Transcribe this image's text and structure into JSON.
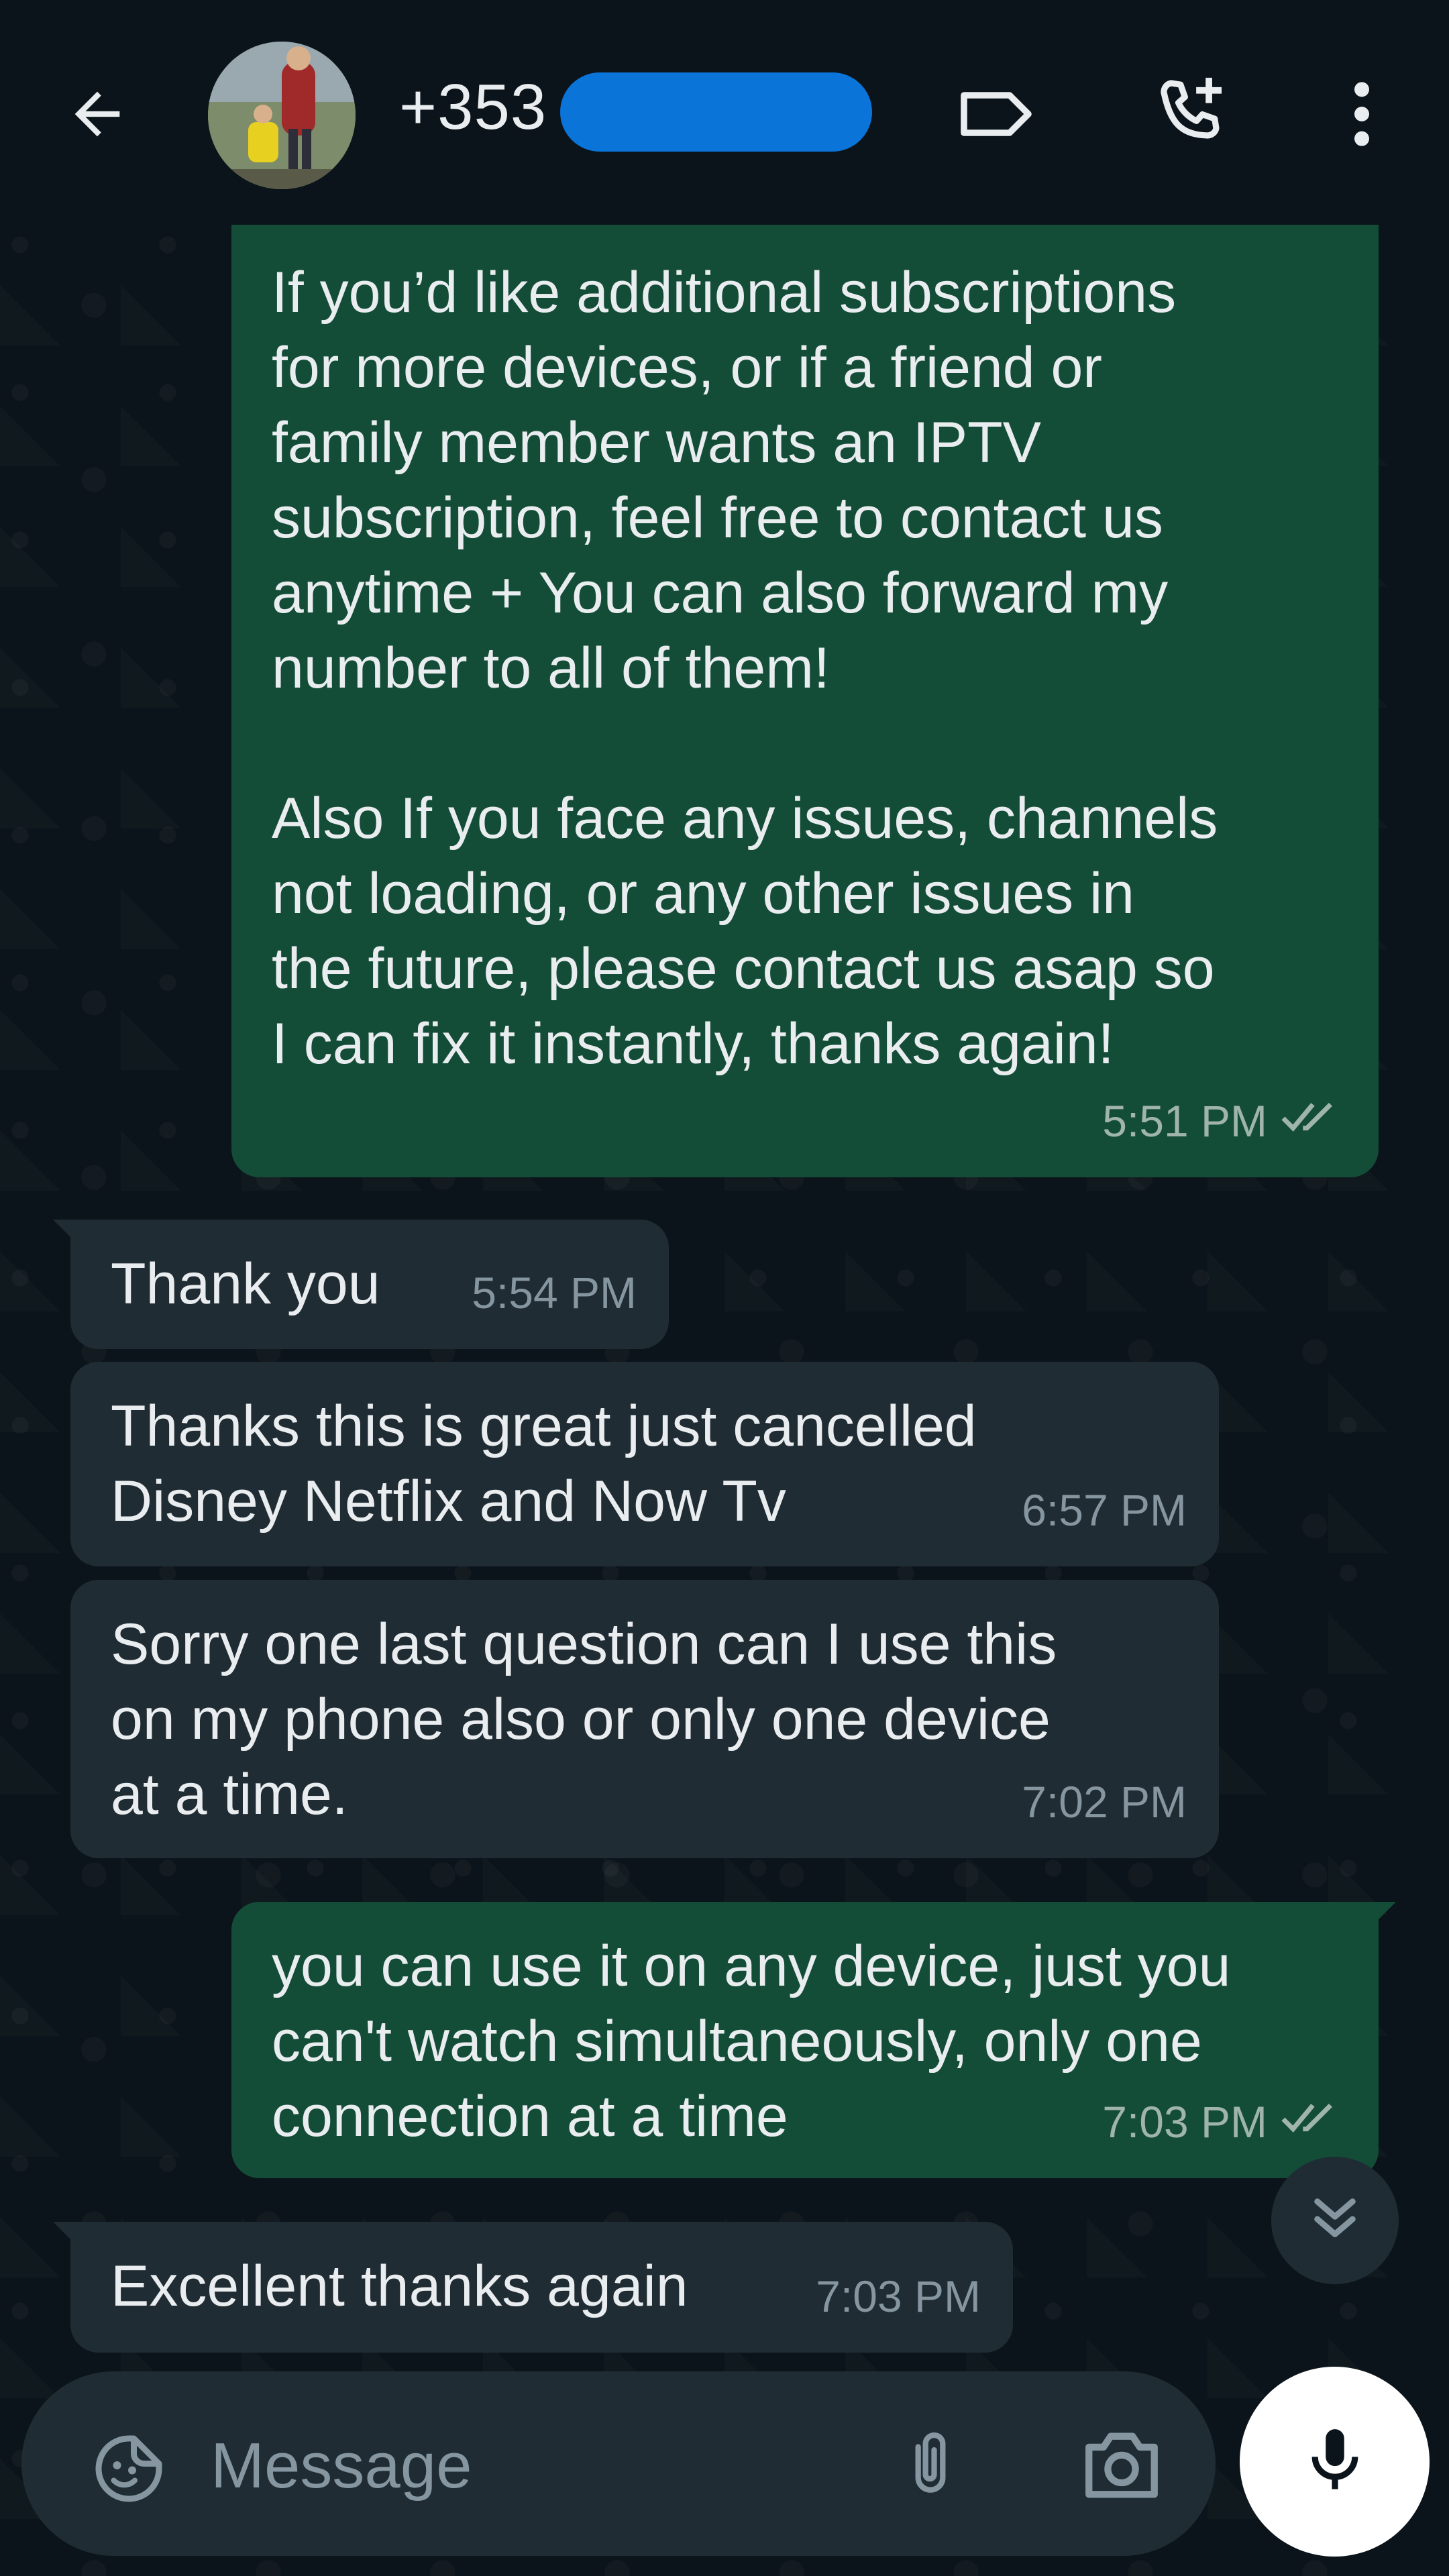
{
  "header": {
    "contact_name": "+353"
  },
  "messages": [
    {
      "direction": "outgoing",
      "text": "If you’d like additional subscriptions\nfor more devices, or if a friend or\nfamily member wants an IPTV\nsubscription, feel free to contact us\nanytime + You can also forward my\nnumber to all of them!\n\nAlso If you face any issues, channels\nnot loading, or any other issues in\nthe future, please contact us asap so\nI can fix it instantly, thanks again!",
      "time": "5:51 PM",
      "status": "read"
    },
    {
      "direction": "incoming",
      "text": "Thank you",
      "time": "5:54 PM"
    },
    {
      "direction": "incoming",
      "text": "Thanks this is great just cancelled\nDisney Netflix and Now Tv",
      "time": "6:57 PM"
    },
    {
      "direction": "incoming",
      "text": "Sorry one last question can I use this\non my phone also or only one device\nat a time.",
      "time": "7:02 PM"
    },
    {
      "direction": "outgoing",
      "text": "you can use it on any device, just you\ncan't watch simultaneously, only one\nconnection at a time",
      "time": "7:03 PM",
      "status": "read"
    },
    {
      "direction": "incoming",
      "text": "Excellent thanks again",
      "time": "7:03 PM"
    }
  ],
  "composer": {
    "placeholder": "Message"
  },
  "colors": {
    "background": "#0b141a",
    "outgoing_bubble": "#144d37",
    "incoming_bubble": "#202c33",
    "read_ticks": "#9fb4aa",
    "redaction": "#0a74d8"
  },
  "icons": [
    "back-arrow-icon",
    "label-icon",
    "add-call-icon",
    "more-vert-icon",
    "double-chevron-down-icon",
    "sticker-icon",
    "attach-icon",
    "camera-icon",
    "mic-icon",
    "double-check-icon"
  ]
}
